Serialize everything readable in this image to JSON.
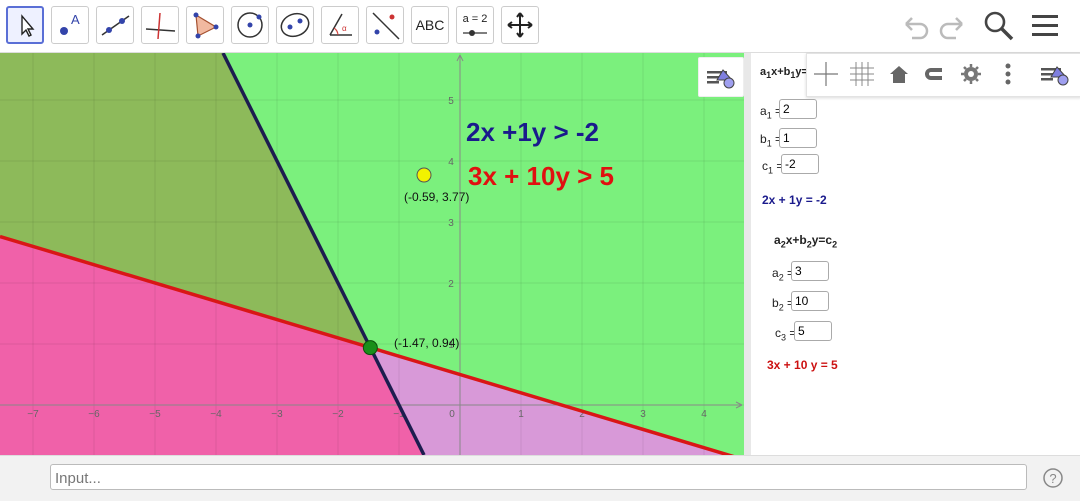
{
  "toolbar": {
    "tools": [
      {
        "name": "move-tool",
        "icon": "arrow-pointer-icon"
      },
      {
        "name": "point-tool",
        "icon": "point-icon"
      },
      {
        "name": "line-tool",
        "icon": "line-icon"
      },
      {
        "name": "perpendicular-line-tool",
        "icon": "perpendicular-icon"
      },
      {
        "name": "polygon-tool",
        "icon": "polygon-icon"
      },
      {
        "name": "circle-tool",
        "icon": "circle-icon"
      },
      {
        "name": "ellipse-tool",
        "icon": "ellipse-icon"
      },
      {
        "name": "angle-tool",
        "icon": "angle-icon"
      },
      {
        "name": "reflect-tool",
        "icon": "reflect-icon"
      },
      {
        "name": "text-tool",
        "icon": "abc-icon",
        "label": "ABC"
      },
      {
        "name": "slider-tool",
        "icon": "slider-icon",
        "label": "a = 2"
      },
      {
        "name": "move-graphics-tool",
        "icon": "move-arrows-icon"
      }
    ],
    "right": [
      "undo-icon",
      "redo-icon",
      "search-icon",
      "menu-icon"
    ]
  },
  "graphics": {
    "x_ticks": [
      "−7",
      "−6",
      "−5",
      "−4",
      "−3",
      "−2",
      "−1",
      "0",
      "1",
      "2",
      "3",
      "4"
    ],
    "y_ticks": [
      "1",
      "2",
      "3",
      "4",
      "5"
    ],
    "inequality1": "2x +1y > -2",
    "inequality2": "3x + 10y > 5",
    "point_a_label": "(-0.59, 3.77)",
    "point_b_label": "(-1.47, 0.94)",
    "colors": {
      "green_region": "#7bf07d",
      "olive_region": "#8dba5a",
      "pink_region": "#f061a9",
      "purple_region": "#d899d8",
      "line1": "#1d1d4f",
      "line2": "#d91616",
      "eq1_text": "#1a1a8c",
      "eq2_text": "#e01010",
      "point_a": "#f2f200",
      "point_b": "#1a8f1a"
    }
  },
  "algebra": {
    "header": "a₁x+b₁y=",
    "a1_label": "a₁ =",
    "a1_value": "2",
    "b1_label": "b₁ =",
    "b1_value": "1",
    "c1_label": "c₁ =",
    "c1_value": "-2",
    "eq1": "2x + 1y = -2",
    "header2": "a₂x+b₂y=c₂",
    "a2_label": "a₂ =",
    "a2_value": "3",
    "b2_label": "b₂ =",
    "b2_value": "10",
    "c3_label": "c₃ =",
    "c3_value": "5",
    "eq2": "3x + 10 y = 5",
    "toolbar_icons": [
      "axes-icon",
      "grid-icon",
      "home-icon",
      "magnet-icon",
      "settings-gear-icon",
      "more-vertical-icon",
      "style-bar-icon"
    ]
  },
  "inputbar": {
    "placeholder": "Input...",
    "help": "?"
  }
}
